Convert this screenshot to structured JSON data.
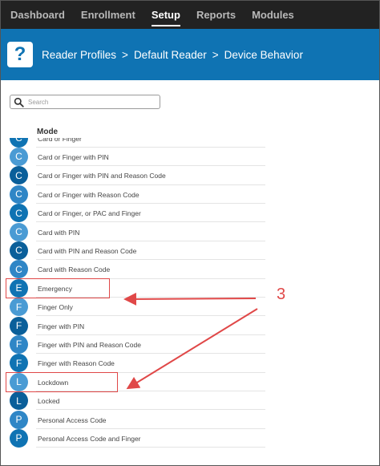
{
  "nav": {
    "items": [
      {
        "label": "Dashboard",
        "active": false
      },
      {
        "label": "Enrollment",
        "active": false
      },
      {
        "label": "Setup",
        "active": true
      },
      {
        "label": "Reports",
        "active": false
      },
      {
        "label": "Modules",
        "active": false
      }
    ]
  },
  "banner": {
    "help_icon": "question-mark-icon",
    "help_glyph": "?",
    "breadcrumb": [
      "Reader Profiles",
      "Default Reader",
      "Device Behavior"
    ],
    "separator": ">"
  },
  "search": {
    "placeholder": "Search",
    "value": "",
    "icon": "magnifier-icon"
  },
  "table": {
    "column_header": "Mode",
    "rows": [
      {
        "letter": "C",
        "label": "Card or Finger"
      },
      {
        "letter": "C",
        "label": "Card or Finger with PIN"
      },
      {
        "letter": "C",
        "label": "Card or Finger with PIN and Reason Code"
      },
      {
        "letter": "C",
        "label": "Card or Finger with Reason Code"
      },
      {
        "letter": "C",
        "label": "Card or Finger, or PAC and Finger"
      },
      {
        "letter": "C",
        "label": "Card with PIN"
      },
      {
        "letter": "C",
        "label": "Card with PIN and Reason Code"
      },
      {
        "letter": "C",
        "label": "Card with Reason Code"
      },
      {
        "letter": "E",
        "label": "Emergency"
      },
      {
        "letter": "F",
        "label": "Finger Only"
      },
      {
        "letter": "F",
        "label": "Finger with PIN"
      },
      {
        "letter": "F",
        "label": "Finger with PIN and Reason Code"
      },
      {
        "letter": "F",
        "label": "Finger with Reason Code"
      },
      {
        "letter": "L",
        "label": "Lockdown"
      },
      {
        "letter": "L",
        "label": "Locked"
      },
      {
        "letter": "P",
        "label": "Personal Access Code"
      },
      {
        "letter": "P",
        "label": "Personal Access Code and Finger"
      }
    ]
  },
  "annotation": {
    "callout_number": "3",
    "highlighted_rows": [
      "Emergency",
      "Lockdown"
    ]
  },
  "colors": {
    "nav_bg": "#222222",
    "banner_bg": "#0f73b3",
    "avatar_shades": [
      "#0f73b3",
      "#4a9bd4",
      "#0a5f9a",
      "#2f86c6"
    ],
    "annotation_red": "#e04848"
  }
}
